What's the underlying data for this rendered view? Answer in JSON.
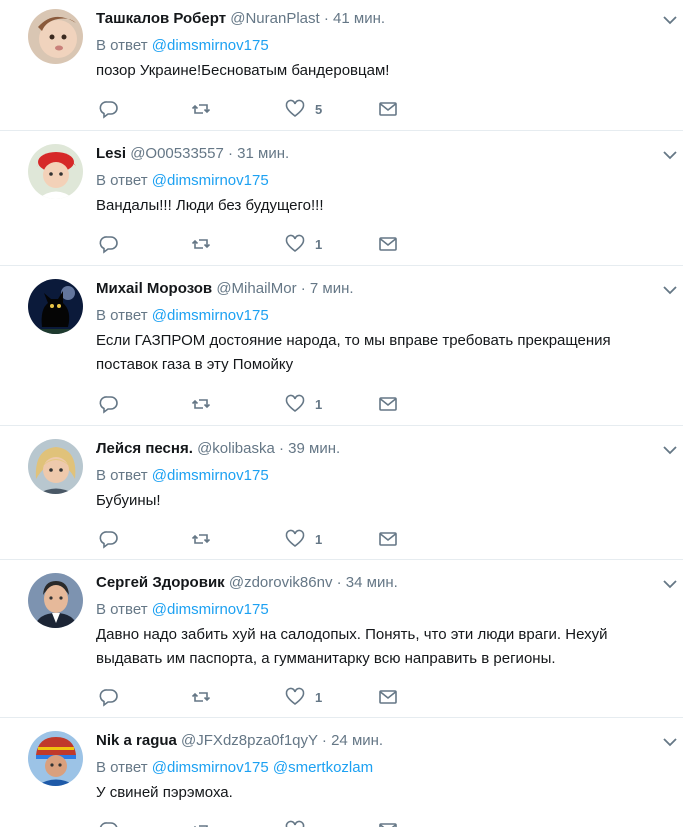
{
  "reply_label": "В ответ",
  "tweets": [
    {
      "name": "Ташкалов Роберт",
      "handle": "@NuranPlast",
      "time": "41 мин.",
      "mentions": [
        "@dimsmirnov175"
      ],
      "text": "позор Украине!Бесноватым бандеровцам!",
      "likes": "5",
      "avatar": "child-portrait"
    },
    {
      "name": "Lesi",
      "handle": "@O00533557",
      "time": "31 мин.",
      "mentions": [
        "@dimsmirnov175"
      ],
      "text": "Вандалы!!! Люди без будущего!!!",
      "likes": "1",
      "avatar": "girl-red-hat"
    },
    {
      "name": "Михаil Морозов",
      "handle": "@MihailMor",
      "time": "7 мин.",
      "mentions": [
        "@dimsmirnov175"
      ],
      "text": "Если ГАЗПРОМ достояние народа, то мы вправе требовать прекращения поставок газа в эту Помойку",
      "likes": "1",
      "avatar": "black-cat"
    },
    {
      "name": "Лейся песня.",
      "handle": "@kolibaska",
      "time": "39 мин.",
      "mentions": [
        "@dimsmirnov175"
      ],
      "text": "Бубуины!",
      "likes": "1",
      "avatar": "blonde-woman"
    },
    {
      "name": "Сергей Здоровик",
      "handle": "@zdorovik86nv",
      "time": "34 мин.",
      "mentions": [
        "@dimsmirnov175"
      ],
      "text": "Давно надо забить хуй на салодопых. Понять, что эти люди враги. Нехуй выдавать им паспорта, а гумманитарку всю направить в регионы.",
      "likes": "1",
      "avatar": "man-portrait"
    },
    {
      "name": "Nik a ragua",
      "handle": "@JFXdz8pza0f1qyY",
      "time": "24 мин.",
      "mentions": [
        "@dimsmirnov175",
        "@smertkozlam"
      ],
      "text": "У свиней пэрэмоха.",
      "likes": "",
      "avatar": "colorful-hat"
    }
  ],
  "icons": {
    "reply": "reply-icon",
    "retweet": "retweet-icon",
    "like": "heart-icon",
    "dm": "envelope-icon",
    "more": "chevron-down-icon"
  },
  "colors": {
    "link": "#1da1f2",
    "muted": "#657786",
    "text": "#14171a",
    "divider": "#e6ecf0"
  }
}
